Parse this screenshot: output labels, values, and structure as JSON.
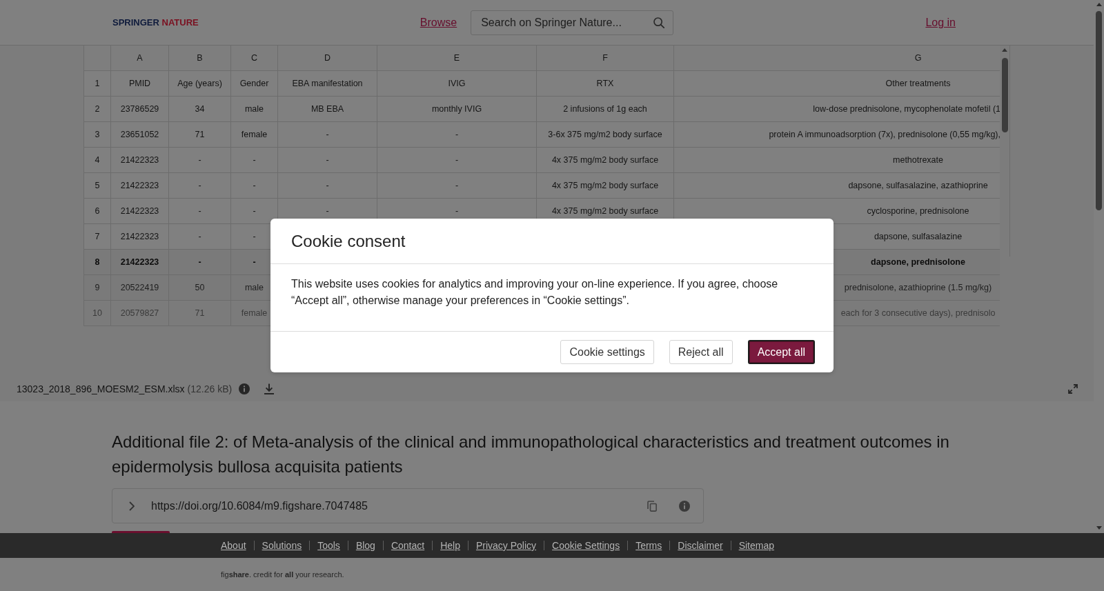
{
  "header": {
    "logo": {
      "part_1": "SPRINGER",
      "part_2": "NATURE"
    },
    "browse_link": "Browse",
    "search": {
      "placeholder": "Search on Springer Nature..."
    },
    "login_link": "Log in"
  },
  "preview": {
    "sheet": {
      "columns": [
        "A",
        "B",
        "C",
        "D",
        "E",
        "F",
        "G"
      ],
      "rows": [
        {
          "number": "1",
          "cells": [
            "PMID",
            "Age (years)",
            "Gender",
            "EBA manifestation",
            "IVIG",
            "RTX",
            "Other treatments"
          ]
        },
        {
          "number": "2",
          "cells": [
            "23786529",
            "34",
            "male",
            "MB EBA",
            "monthly IVIG",
            "2 infusions of 1g each",
            "low-dose prednisolone, mycophenolate mofetil (1"
          ]
        },
        {
          "number": "3",
          "cells": [
            "23651052",
            "71",
            "female",
            "-",
            "-",
            "3-6x 375 mg/m2 body surface",
            "protein A immunoadsorption (7x), prednisolone (0,55 mg/kg),"
          ]
        },
        {
          "number": "4",
          "cells": [
            "21422323",
            "-",
            "-",
            "-",
            "-",
            "4x 375 mg/m2 body surface",
            "methotrexate"
          ]
        },
        {
          "number": "5",
          "cells": [
            "21422323",
            "-",
            "-",
            "-",
            "-",
            "4x 375 mg/m2 body surface",
            "dapsone, sulfasalazine, azathioprine"
          ]
        },
        {
          "number": "6",
          "cells": [
            "21422323",
            "-",
            "-",
            "-",
            "-",
            "4x 375 mg/m2 body surface",
            "cyclosporine, prednisolone"
          ]
        },
        {
          "number": "7",
          "cells": [
            "21422323",
            "-",
            "-",
            null,
            null,
            null,
            "dapsone, sulfasalazine"
          ]
        },
        {
          "number": "8",
          "cells": [
            "21422323",
            "-",
            "-",
            null,
            null,
            null,
            "dapsone, prednisolone"
          ]
        },
        {
          "number": "9",
          "cells": [
            "20522419",
            "50",
            "male",
            null,
            null,
            null,
            "prednisolone, azathioprine (1.5 mg/kg)"
          ]
        },
        {
          "number": "10",
          "cells": [
            "20579827",
            "71",
            "female",
            null,
            null,
            null,
            "each for 3 consecutive days), prednisolo"
          ]
        }
      ]
    },
    "file": {
      "name": "13023_2018_896_MOESM2_ESM.xlsx",
      "size": "(12.26 kB)"
    }
  },
  "file_details": {
    "title": "Additional file 2: of Meta-analysis of the clinical and immunopathological characteristics and treatment outcomes in epidermolysis bullosa acquisita patients",
    "doi_link": "https://doi.org/10.6084/m9.figshare.7047485"
  },
  "footer": {
    "links": [
      "About",
      "Solutions",
      "Tools",
      "Blog",
      "Contact",
      "Help",
      "Privacy Policy",
      "Cookie Settings",
      "Terms",
      "Disclaimer",
      "Sitemap"
    ],
    "tagline": "fig**share**. credit for **all** your research."
  },
  "cookie_dialog": {
    "title": "Cookie consent",
    "message": "This website uses cookies for analytics and improving your on-line experience. If you agree, choose “Accept all”, otherwise manage your preferences in “Cookie settings”.",
    "buttons": [
      {
        "label": "Cookie settings",
        "kind": "secondary",
        "focused": false
      },
      {
        "label": "Reject all",
        "kind": "secondary",
        "focused": false
      },
      {
        "label": "Accept all",
        "kind": "primary",
        "focused": true
      }
    ]
  }
}
